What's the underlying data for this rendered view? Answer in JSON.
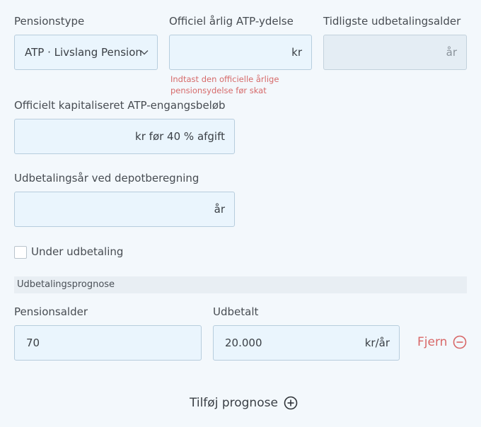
{
  "fields": {
    "pension_type": {
      "label": "Pensionstype",
      "value": "ATP · Livslang Pension"
    },
    "official_annual": {
      "label": "Officiel årlig ATP-ydelse",
      "suffix": "kr",
      "value": "",
      "error": "Indtast den officielle årlige pensionsydelse før skat"
    },
    "earliest_age": {
      "label": "Tidligste udbetalingsalder",
      "suffix": "år",
      "value": ""
    },
    "capitalized": {
      "label": "Officielt kapitaliseret ATP-engangsbeløb",
      "suffix": "kr før 40 % afgift",
      "value": ""
    },
    "payout_years": {
      "label": "Udbetalingsår ved depotberegning",
      "suffix": "år",
      "value": ""
    },
    "under_payout": {
      "label": "Under udbetaling",
      "checked": false
    }
  },
  "forecast": {
    "section_title": "Udbetalingsprognose",
    "age_label": "Pensionsalder",
    "paid_label": "Udbetalt",
    "rows": [
      {
        "age": "70",
        "paid": "20.000",
        "unit": "kr/år",
        "remove_label": "Fjern"
      }
    ],
    "add_label": "Tilføj prognose"
  },
  "colors": {
    "error": "#d66a6a",
    "remove": "#d86767",
    "field_bg": "#eaf5fd",
    "page_bg": "#f3f8fc"
  }
}
